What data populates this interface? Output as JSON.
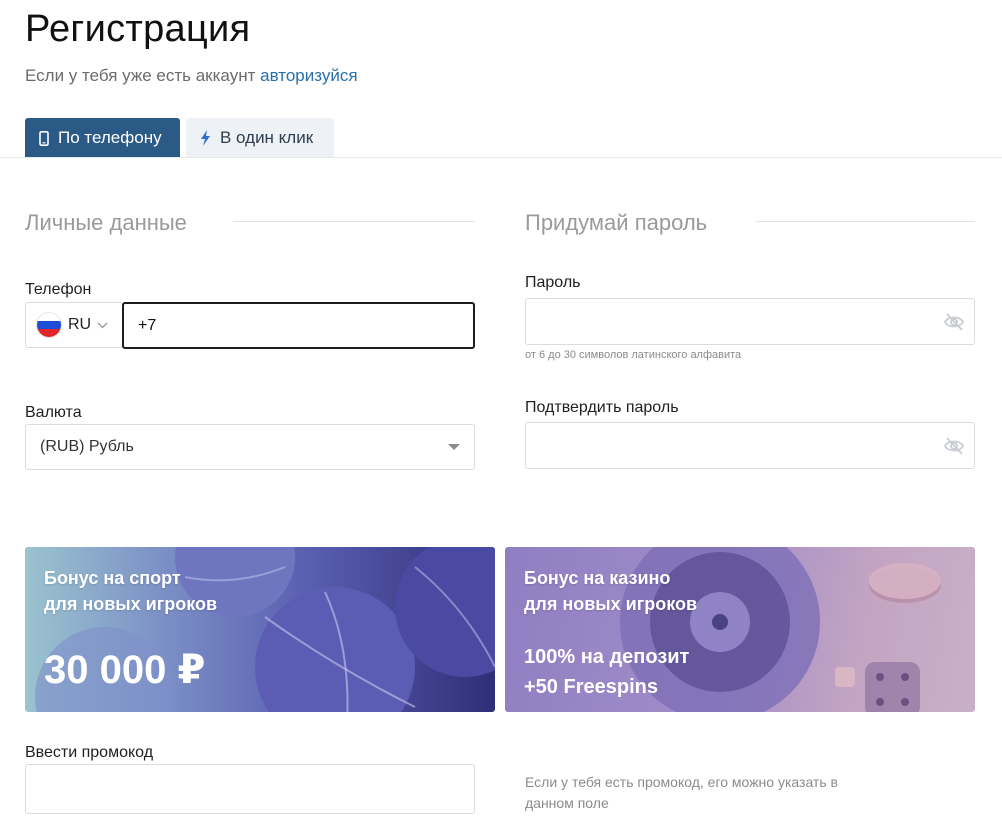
{
  "header": {
    "title": "Регистрация",
    "subtitle_prefix": "Если у тебя уже есть аккаунт",
    "login_link": "авторизуйся"
  },
  "tabs": [
    {
      "label": "По телефону",
      "icon": "phone-icon",
      "active": true
    },
    {
      "label": "В один клик",
      "icon": "lightning-icon",
      "active": false
    }
  ],
  "personal": {
    "section_title": "Личные данные",
    "phone_label": "Телефон",
    "country_code": "RU",
    "phone_value": "+7",
    "currency_label": "Валюта",
    "currency_value": "(RUB) Рубль"
  },
  "password": {
    "section_title": "Придумай пароль",
    "password_label": "Пароль",
    "password_hint": "от 6 до 30 символов латинского алфавита",
    "confirm_label": "Подтвердить пароль"
  },
  "banners": {
    "sport": {
      "line1": "Бонус на спорт",
      "line2": "для новых игроков",
      "amount": "30 000 ₽"
    },
    "casino": {
      "line1": "Бонус на казино",
      "line2": "для новых игроков",
      "offer1": "100% на депозит",
      "offer2": "+50 Freespins"
    }
  },
  "promo": {
    "label": "Ввести промокод",
    "hint": "Если у тебя есть промокод, его можно указать в данном поле"
  },
  "colors": {
    "accent": "#2c5a87",
    "link": "#2a6fa8",
    "inactive_tab": "#eef2f6"
  }
}
